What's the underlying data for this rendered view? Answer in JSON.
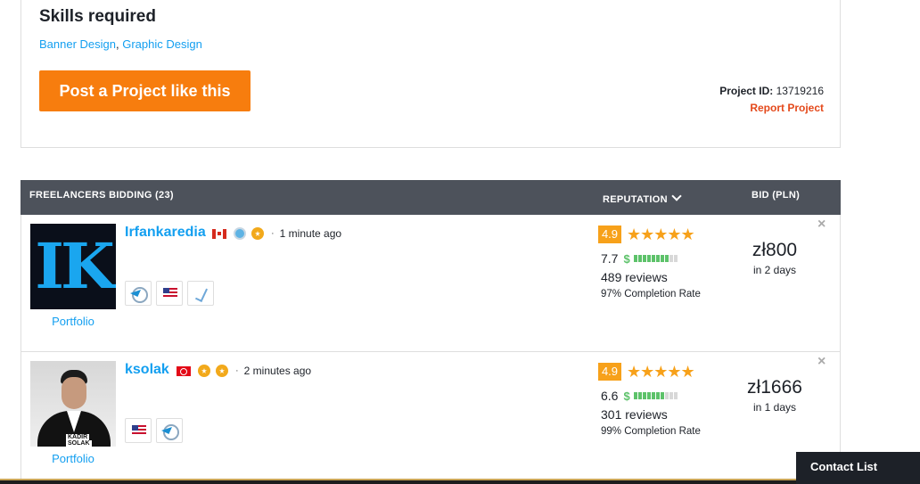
{
  "skills_section": {
    "title": "Skills required",
    "skills": [
      "Banner Design",
      "Graphic Design"
    ],
    "separator": ", "
  },
  "post_button": "Post a Project like this",
  "project": {
    "id_label": "Project ID:",
    "id_value": "13719216",
    "report_label": "Report Project"
  },
  "bids_header": {
    "freelancers": "FREELANCERS BIDDING (23)",
    "reputation": "REPUTATION",
    "bid": "BID (PLN)"
  },
  "bids": [
    {
      "username": "Irfankaredia",
      "country_flag": "canada-flag",
      "badges": [
        "verified-icon",
        "preferred-freelancer-icon"
      ],
      "dot": "·",
      "time": "1 minute ago",
      "certifications": [
        "on-time-icon",
        "us-english-icon",
        "verified-check-icon"
      ],
      "avatar_text": "IK",
      "portfolio": "Portfolio",
      "rating": "4.9",
      "stars": "★★★★★",
      "earnings_score": "7.7",
      "earnings_level": 0.8,
      "reviews": "489 reviews",
      "completion": "97% Completion Rate",
      "amount": "zł800",
      "delivery": "in 2 days"
    },
    {
      "username": "ksolak",
      "country_flag": "turkey-flag",
      "badges": [
        "preferred-freelancer-icon",
        "recommended-icon"
      ],
      "dot": "·",
      "time": "2 minutes ago",
      "certifications": [
        "us-english-icon",
        "on-time-icon"
      ],
      "avatar_caption": "KADIR",
      "avatar_caption_2": "SOLAK",
      "portfolio": "Portfolio",
      "rating": "4.9",
      "stars": "★★★★★",
      "earnings_score": "6.6",
      "earnings_level": 0.7,
      "reviews": "301 reviews",
      "completion": "99% Completion Rate",
      "amount": "zł1666",
      "delivery": "in 1 days"
    }
  ],
  "close_symbol": "×",
  "contact_list": "Contact List",
  "colors": {
    "accent_orange": "#f77d0e",
    "link_blue": "#139ff0",
    "header_gray": "#4d525b",
    "report_red": "#e4491b",
    "rating_orange": "#f7a11a",
    "earnings_green": "#5dc26a"
  }
}
